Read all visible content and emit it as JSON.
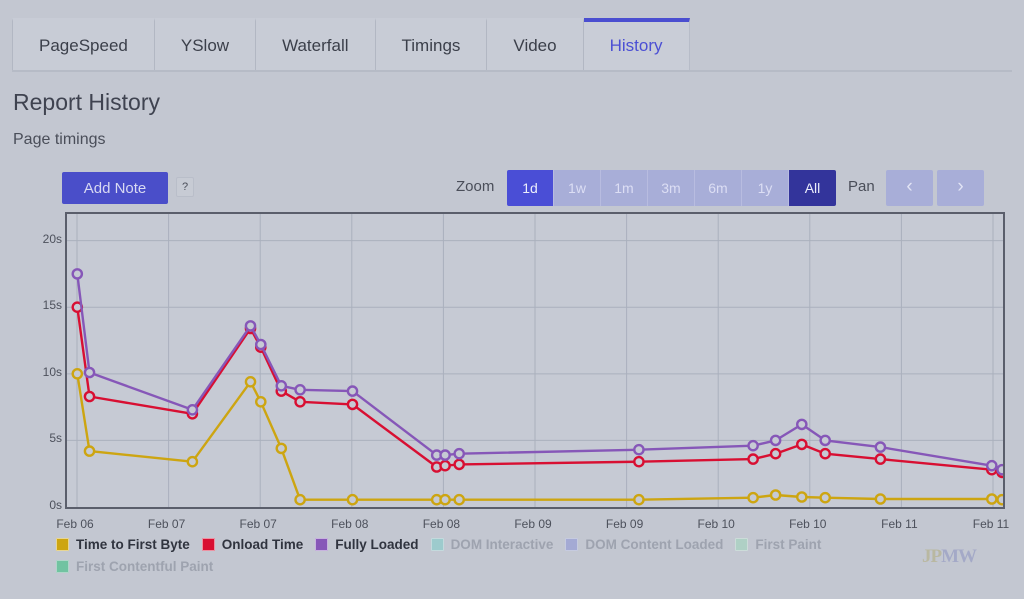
{
  "tabs": [
    {
      "label": "PageSpeed",
      "active": false
    },
    {
      "label": "YSlow",
      "active": false
    },
    {
      "label": "Waterfall",
      "active": false
    },
    {
      "label": "Timings",
      "active": false
    },
    {
      "label": "Video",
      "active": false
    },
    {
      "label": "History",
      "active": true
    }
  ],
  "page": {
    "title": "Report History",
    "subtitle": "Page timings"
  },
  "toolbar": {
    "add_note_label": "Add Note",
    "help_label": "?",
    "zoom_label": "Zoom",
    "pan_label": "Pan",
    "pan_prev_icon": "chevron-left-icon",
    "pan_next_icon": "chevron-right-icon",
    "pan_prev_glyph": "‹",
    "pan_next_glyph": "›",
    "zoom_options": [
      {
        "label": "1d",
        "state": "highlight"
      },
      {
        "label": "1w",
        "state": "normal"
      },
      {
        "label": "1m",
        "state": "normal"
      },
      {
        "label": "3m",
        "state": "normal"
      },
      {
        "label": "6m",
        "state": "normal"
      },
      {
        "label": "1y",
        "state": "normal"
      },
      {
        "label": "All",
        "state": "selected"
      }
    ]
  },
  "watermark": {
    "part1": "JP",
    "part2": "MW"
  },
  "colors": {
    "accent": "#4a4ed0",
    "ttfb": "#cda511",
    "onload": "#d80f32",
    "fully_loaded": "#8657b8",
    "dom_interactive": "#7fd0cb",
    "dom_content_loaded": "#8b94d8",
    "first_paint": "#9fd9bc",
    "first_contentful_paint": "#2fc07a",
    "plot_bg": "#c6cad4",
    "page_bg": "#c3c7d1"
  },
  "chart_data": {
    "type": "line",
    "title": "Page timings",
    "xlabel": "",
    "ylabel": "",
    "ylim": [
      0,
      22
    ],
    "yticks": [
      0,
      5,
      10,
      15,
      20
    ],
    "ytick_labels": [
      "0s",
      "5s",
      "10s",
      "15s",
      "20s"
    ],
    "grid": true,
    "legend_position": "bottom",
    "x_tick_labels": [
      "Feb 06",
      "Feb 07",
      "Feb 07",
      "Feb 08",
      "Feb 08",
      "Feb 09",
      "Feb 09",
      "Feb 10",
      "Feb 10",
      "Feb 11",
      "Feb 11"
    ],
    "x": [
      0,
      1,
      2,
      3,
      4,
      5,
      6,
      7,
      8,
      9,
      10,
      11,
      12,
      13,
      14,
      15,
      16,
      17,
      18,
      19,
      20,
      21
    ],
    "x_positions": [
      0.011,
      0.024,
      0.134,
      0.196,
      0.207,
      0.229,
      0.249,
      0.305,
      0.395,
      0.404,
      0.419,
      0.611,
      0.733,
      0.757,
      0.785,
      0.81,
      0.869,
      0.988,
      0.999
    ],
    "series": [
      {
        "name": "Time to First Byte",
        "color": "#cda511",
        "visible": true,
        "values": [
          10.0,
          4.2,
          3.4,
          9.4,
          7.9,
          4.4,
          0.55,
          0.55,
          0.55,
          0.55,
          0.55,
          0.55,
          0.7,
          0.9,
          0.75,
          0.7,
          0.6,
          0.6,
          0.55
        ]
      },
      {
        "name": "Onload Time",
        "color": "#d80f32",
        "visible": true,
        "values": [
          15.0,
          8.3,
          7.0,
          13.4,
          12.0,
          8.7,
          7.9,
          7.7,
          3.0,
          3.1,
          3.2,
          3.4,
          3.6,
          4.0,
          4.7,
          4.0,
          3.6,
          2.8,
          2.6
        ]
      },
      {
        "name": "Fully Loaded",
        "color": "#8657b8",
        "visible": true,
        "values": [
          17.5,
          10.1,
          7.3,
          13.6,
          12.2,
          9.1,
          8.8,
          8.7,
          3.9,
          3.9,
          4.0,
          4.3,
          4.6,
          5.0,
          6.2,
          5.0,
          4.5,
          3.1,
          2.8
        ]
      },
      {
        "name": "DOM Interactive",
        "color": "#7fd0cb",
        "visible": false,
        "values": []
      },
      {
        "name": "DOM Content Loaded",
        "color": "#8b94d8",
        "visible": false,
        "values": []
      },
      {
        "name": "First Paint",
        "color": "#9fd9bc",
        "visible": false,
        "values": []
      },
      {
        "name": "First Contentful Paint",
        "color": "#2fc07a",
        "visible": false,
        "values": []
      }
    ]
  }
}
